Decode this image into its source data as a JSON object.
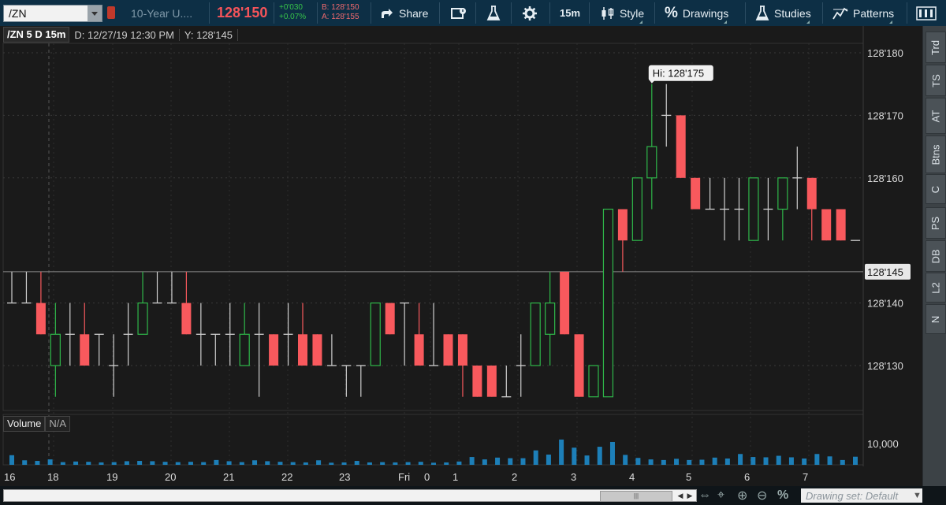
{
  "toolbar": {
    "symbol": "/ZN",
    "description": "10-Year U....",
    "last": "128'150",
    "change": "+0'030",
    "change_pct": "+0.07%",
    "bid": "B: 128'150",
    "ask": "A: 128'155",
    "share": "Share",
    "timeframe": "15m",
    "style": "Style",
    "drawings": "Drawings",
    "studies": "Studies",
    "patterns": "Patterns"
  },
  "info": {
    "symbol_period": "/ZN 5 D 15m",
    "date": "D: 12/27/19 12:30 PM",
    "y": "Y: 128'145"
  },
  "volume": {
    "label": "Volume",
    "value": "N/A",
    "axis_tick": "10,000"
  },
  "price_axis": {
    "ticks": [
      "128'180",
      "128'170",
      "128'160",
      "128'140",
      "128'130"
    ],
    "current": "128'145"
  },
  "hi_label": "Hi: 128'175",
  "time_axis": [
    "16",
    "18",
    "19",
    "20",
    "21",
    "22",
    "23",
    "Fri",
    "0",
    "1",
    "2",
    "3",
    "4",
    "5",
    "6",
    "7"
  ],
  "sidebar": [
    "Trd",
    "TS",
    "AT",
    "Btns",
    "C",
    "PS",
    "DB",
    "L2",
    "N"
  ],
  "bottom": {
    "drawing_set": "Drawing set: Default"
  },
  "colors": {
    "up": "#2fb84a",
    "down": "#f8595d",
    "doji": "#cfcfcf",
    "volume": "#1d7fb8",
    "last": "#f5545a"
  },
  "chart_data": {
    "type": "candlestick",
    "y_unit": "32nds",
    "ylim": [
      "128'125",
      "128'185"
    ],
    "candles": [
      {
        "o": "128'140",
        "h": "128'145",
        "l": "128'140",
        "c": "128'140"
      },
      {
        "o": "128'140",
        "h": "128'145",
        "l": "128'140",
        "c": "128'140"
      },
      {
        "o": "128'140",
        "h": "128'145",
        "l": "128'135",
        "c": "128'135"
      },
      {
        "o": "128'130",
        "h": "128'140",
        "l": "128'125",
        "c": "128'135"
      },
      {
        "o": "128'135",
        "h": "128'140",
        "l": "128'130",
        "c": "128'135"
      },
      {
        "o": "128'135",
        "h": "128'140",
        "l": "128'130",
        "c": "128'130"
      },
      {
        "o": "128'135",
        "h": "128'135",
        "l": "128'130",
        "c": "128'135"
      },
      {
        "o": "128'130",
        "h": "128'135",
        "l": "128'125",
        "c": "128'130"
      },
      {
        "o": "128'135",
        "h": "128'140",
        "l": "128'130",
        "c": "128'135"
      },
      {
        "o": "128'135",
        "h": "128'145",
        "l": "128'135",
        "c": "128'140"
      },
      {
        "o": "128'140",
        "h": "128'145",
        "l": "128'140",
        "c": "128'140"
      },
      {
        "o": "128'140",
        "h": "128'145",
        "l": "128'140",
        "c": "128'140"
      },
      {
        "o": "128'140",
        "h": "128'145",
        "l": "128'135",
        "c": "128'135"
      },
      {
        "o": "128'135",
        "h": "128'140",
        "l": "128'130",
        "c": "128'135"
      },
      {
        "o": "128'135",
        "h": "128'135",
        "l": "128'130",
        "c": "128'135"
      },
      {
        "o": "128'135",
        "h": "128'140",
        "l": "128'130",
        "c": "128'135"
      },
      {
        "o": "128'130",
        "h": "128'140",
        "l": "128'130",
        "c": "128'135"
      },
      {
        "o": "128'135",
        "h": "128'140",
        "l": "128'125",
        "c": "128'135"
      },
      {
        "o": "128'135",
        "h": "128'135",
        "l": "128'130",
        "c": "128'130"
      },
      {
        "o": "128'135",
        "h": "128'140",
        "l": "128'130",
        "c": "128'135"
      },
      {
        "o": "128'135",
        "h": "128'140",
        "l": "128'130",
        "c": "128'130"
      },
      {
        "o": "128'135",
        "h": "128'135",
        "l": "128'130",
        "c": "128'130"
      },
      {
        "o": "128'130",
        "h": "128'135",
        "l": "128'130",
        "c": "128'130"
      },
      {
        "o": "128'130",
        "h": "128'130",
        "l": "128'125",
        "c": "128'130"
      },
      {
        "o": "128'130",
        "h": "128'130",
        "l": "128'125",
        "c": "128'130"
      },
      {
        "o": "128'130",
        "h": "128'140",
        "l": "128'130",
        "c": "128'140"
      },
      {
        "o": "128'140",
        "h": "128'140",
        "l": "128'135",
        "c": "128'135"
      },
      {
        "o": "128'140",
        "h": "128'140",
        "l": "128'130",
        "c": "128'140"
      },
      {
        "o": "128'135",
        "h": "128'140",
        "l": "128'130",
        "c": "128'130"
      },
      {
        "o": "128'130",
        "h": "128'140",
        "l": "128'130",
        "c": "128'130"
      },
      {
        "o": "128'135",
        "h": "128'135",
        "l": "128'130",
        "c": "128'130"
      },
      {
        "o": "128'135",
        "h": "128'135",
        "l": "128'125",
        "c": "128'130"
      },
      {
        "o": "128'130",
        "h": "128'130",
        "l": "128'125",
        "c": "128'125"
      },
      {
        "o": "128'130",
        "h": "128'130",
        "l": "128'125",
        "c": "128'125"
      },
      {
        "o": "128'125",
        "h": "128'130",
        "l": "128'125",
        "c": "128'125"
      },
      {
        "o": "128'130",
        "h": "128'135",
        "l": "128'125",
        "c": "128'130"
      },
      {
        "o": "128'130",
        "h": "128'140",
        "l": "128'130",
        "c": "128'140"
      },
      {
        "o": "128'135",
        "h": "128'145",
        "l": "128'130",
        "c": "128'140"
      },
      {
        "o": "128'145",
        "h": "128'145",
        "l": "128'135",
        "c": "128'135"
      },
      {
        "o": "128'135",
        "h": "128'135",
        "l": "128'125",
        "c": "128'125"
      },
      {
        "o": "128'125",
        "h": "128'130",
        "l": "128'125",
        "c": "128'130"
      },
      {
        "o": "128'125",
        "h": "128'155",
        "l": "128'125",
        "c": "128'155"
      },
      {
        "o": "128'155",
        "h": "128'155",
        "l": "128'145",
        "c": "128'150"
      },
      {
        "o": "128'150",
        "h": "128'160",
        "l": "128'150",
        "c": "128'160"
      },
      {
        "o": "128'160",
        "h": "128'175",
        "l": "128'155",
        "c": "128'165"
      },
      {
        "o": "128'170",
        "h": "128'175",
        "l": "128'165",
        "c": "128'170"
      },
      {
        "o": "128'170",
        "h": "128'170",
        "l": "128'160",
        "c": "128'160"
      },
      {
        "o": "128'160",
        "h": "128'160",
        "l": "128'155",
        "c": "128'155"
      },
      {
        "o": "128'155",
        "h": "128'160",
        "l": "128'155",
        "c": "128'155"
      },
      {
        "o": "128'155",
        "h": "128'160",
        "l": "128'150",
        "c": "128'155"
      },
      {
        "o": "128'155",
        "h": "128'160",
        "l": "128'150",
        "c": "128'155"
      },
      {
        "o": "128'150",
        "h": "128'160",
        "l": "128'150",
        "c": "128'160"
      },
      {
        "o": "128'155",
        "h": "128'160",
        "l": "128'150",
        "c": "128'155"
      },
      {
        "o": "128'155",
        "h": "128'160",
        "l": "128'150",
        "c": "128'160"
      },
      {
        "o": "128'160",
        "h": "128'165",
        "l": "128'155",
        "c": "128'160"
      },
      {
        "o": "128'160",
        "h": "128'160",
        "l": "128'150",
        "c": "128'155"
      },
      {
        "o": "128'155",
        "h": "128'155",
        "l": "128'150",
        "c": "128'150"
      },
      {
        "o": "128'155",
        "h": "128'155",
        "l": "128'150",
        "c": "128'150"
      },
      {
        "o": "128'150",
        "h": "128'150",
        "l": "128'150",
        "c": "128'150"
      }
    ],
    "volume": [
      3200,
      1500,
      1300,
      1800,
      900,
      1100,
      1000,
      800,
      900,
      1200,
      1300,
      1200,
      1000,
      900,
      1000,
      900,
      1600,
      1200,
      900,
      1500,
      1200,
      1000,
      900,
      800,
      1500,
      700,
      800,
      1300,
      800,
      900,
      800,
      900,
      1000,
      700,
      800,
      1100,
      2600,
      1800,
      2400,
      2200,
      2200,
      4800,
      3400,
      8400,
      5700,
      3100,
      6000,
      7600,
      3300,
      2300,
      1800,
      1600,
      2000,
      1600,
      1700,
      2400,
      2100,
      3600,
      2600,
      2500,
      3000,
      2500,
      2100,
      3600,
      2800,
      1600,
      2700
    ]
  }
}
